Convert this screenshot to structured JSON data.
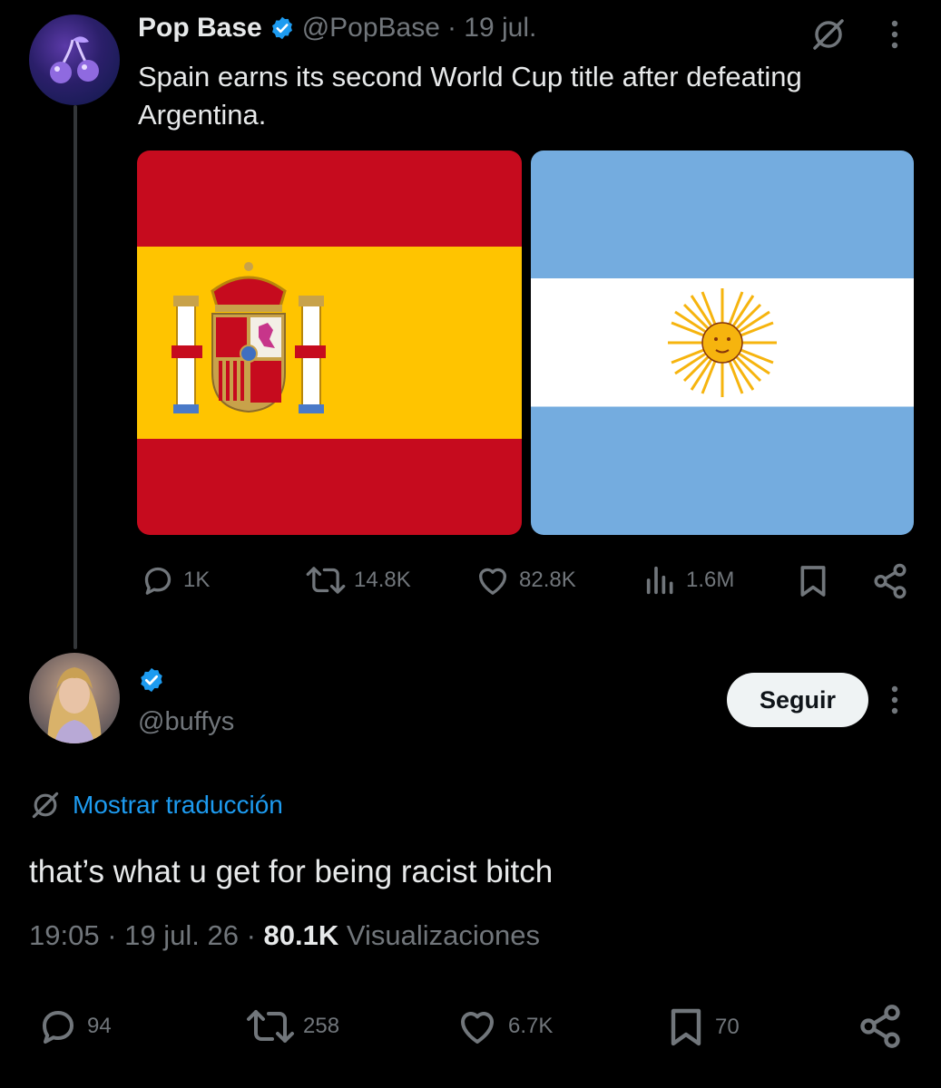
{
  "post": {
    "author_name": "Pop Base",
    "author_handle": "@PopBase",
    "date": "· 19 jul.",
    "text": "Spain earns its second World Cup title after defeating Argentina.",
    "stats": {
      "replies": "1K",
      "reposts": "14.8K",
      "likes": "82.8K",
      "views": "1.6M"
    }
  },
  "reply": {
    "author_handle": "@buffys",
    "follow_label": "Seguir",
    "translate_label": "Mostrar traducción",
    "text": "that’s what u get for being racist bitch",
    "time": "19:05",
    "sep1": " · ",
    "date": "19 jul. 26",
    "sep2": " · ",
    "views_count": "80.1K",
    "views_label": " Visualizaciones",
    "stats": {
      "replies": "94",
      "reposts": "258",
      "likes": "6.7K",
      "bookmarks": "70"
    }
  },
  "colors": {
    "background": "#000000",
    "accent": "#1d9bf0",
    "muted": "#71767b",
    "spain_red": "#c60b1e",
    "spain_yellow": "#ffc400",
    "argentina_blue": "#74acdf"
  },
  "icons": [
    "grok-icon",
    "more-icon",
    "verified-icon",
    "reply-icon",
    "repost-icon",
    "like-icon",
    "views-icon",
    "bookmark-icon",
    "share-icon",
    "translate-icon"
  ]
}
